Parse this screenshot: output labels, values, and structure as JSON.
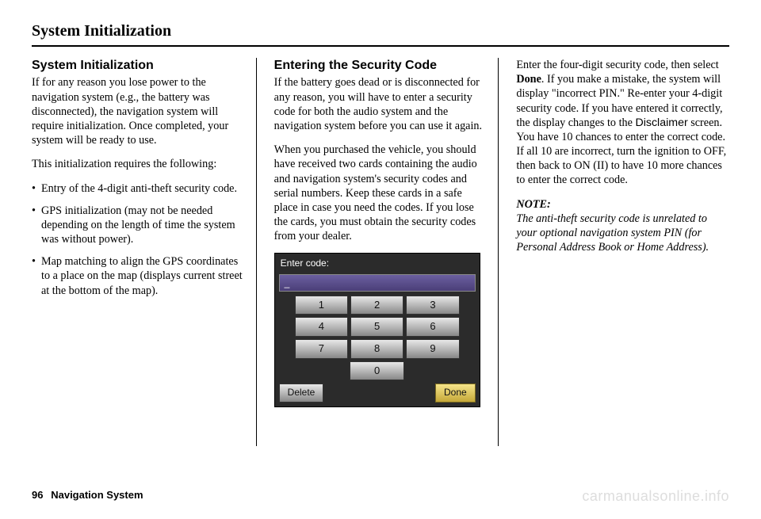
{
  "pageTitle": "System Initialization",
  "col1": {
    "heading": "System Initialization",
    "p1": "If for any reason you lose power to the navigation system (e.g., the battery was disconnected), the navigation system will require initialization. Once completed, your system will be ready to use.",
    "p2": "This initialization requires the following:",
    "bullets": [
      "Entry of the 4-digit anti-theft security code.",
      "GPS initialization (may not be needed depending on the length of time the system was without power).",
      "Map matching to align the GPS coordinates to a place on the map (displays current street at the bottom of the map)."
    ]
  },
  "col2": {
    "heading": "Entering the Security Code",
    "p1": "If the battery goes dead or is disconnected for any reason, you will have to enter a security code for both the audio system and the navigation system before you can use it again.",
    "p2": "When you purchased the vehicle, you should have received two cards containing the audio and navigation system's security codes and serial numbers. Keep these cards in a safe place in case you need the codes. If you lose the cards, you must obtain the security codes from your dealer.",
    "keypad": {
      "title": "Enter code:",
      "entry": "_",
      "keys": [
        "1",
        "2",
        "3",
        "4",
        "5",
        "6",
        "7",
        "8",
        "9"
      ],
      "zero": "0",
      "delete": "Delete",
      "done": "Done"
    }
  },
  "col3": {
    "p1a": "Enter the four-digit security code, then select ",
    "p1b": "Done",
    "p1c": ". If you make a mistake, the system will display \"incorrect PIN.\" Re-enter your 4-digit security code. If you have entered it correctly, the display changes to the ",
    "p1d": "Disclaimer",
    "p1e": " screen. You have 10 chances to enter the correct code. If all 10 are incorrect, turn the ignition to OFF, then back to ON (II) to have 10 more chances to enter the correct code.",
    "noteLabel": "NOTE:",
    "noteText": "The anti-theft security code is unrelated to your optional navigation system PIN (for Personal Address Book or Home Address)."
  },
  "footer": {
    "pageNum": "96",
    "section": "Navigation System"
  },
  "watermark": "carmanualsonline.info"
}
